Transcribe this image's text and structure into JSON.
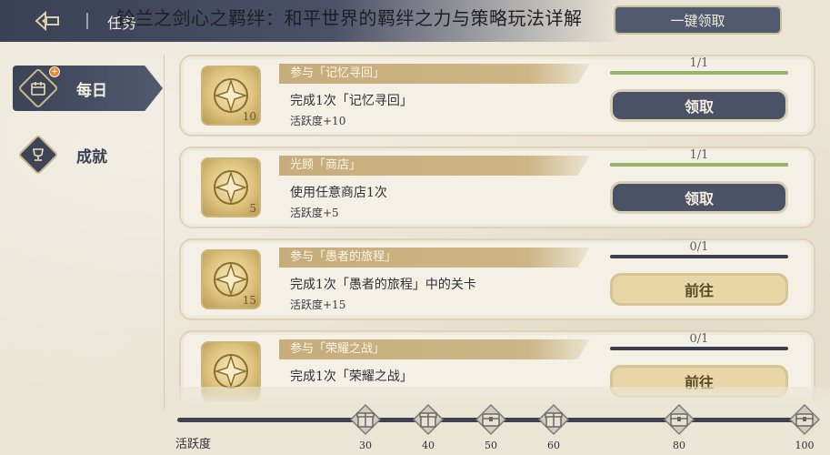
{
  "overlay_title": "铃兰之剑心之羁绊：和平世界的羁绊之力与策略玩法详解",
  "topbar": {
    "title": "任务",
    "top_claim_label": "一键领取"
  },
  "nav": [
    {
      "label": "每日",
      "icon": "calendar-icon",
      "active": true,
      "badge": "+"
    },
    {
      "label": "成就",
      "icon": "trophy-icon",
      "active": false
    }
  ],
  "tasks": [
    {
      "tag": "参与「记忆寻回」",
      "desc": "完成1次「记忆寻回」",
      "reward": "活跃度+10",
      "points": "10",
      "progress_text": "1/1",
      "progress": 1.0,
      "button": "领取",
      "button_type": "claim"
    },
    {
      "tag": "光顾「商店」",
      "desc": "使用任意商店1次",
      "reward": "活跃度+5",
      "points": "5",
      "progress_text": "1/1",
      "progress": 1.0,
      "button": "领取",
      "button_type": "claim"
    },
    {
      "tag": "参与「愚者的旅程」",
      "desc": "完成1次「愚者的旅程」中的关卡",
      "reward": "活跃度+15",
      "points": "15",
      "progress_text": "0/1",
      "progress": 0.0,
      "button": "前往",
      "button_type": "go"
    },
    {
      "tag": "参与「荣耀之战」",
      "desc": "完成1次「荣耀之战」",
      "reward": "",
      "points": "",
      "progress_text": "0/1",
      "progress": 0.0,
      "button": "前往",
      "button_type": "go"
    }
  ],
  "activity": {
    "label": "活跃度",
    "max": 100,
    "milestones": [
      {
        "value": 30,
        "label": "30",
        "icon": "gift-box-icon"
      },
      {
        "value": 40,
        "label": "40",
        "icon": "gift-box-icon"
      },
      {
        "value": 50,
        "label": "50",
        "icon": "treasure-chest-icon"
      },
      {
        "value": 60,
        "label": "60",
        "icon": "gift-box-icon"
      },
      {
        "value": 80,
        "label": "80",
        "icon": "treasure-chest-icon"
      },
      {
        "value": 100,
        "label": "100",
        "icon": "treasure-chest-icon"
      }
    ]
  },
  "colors": {
    "accent_dark": "#4b5266",
    "gold": "#c7ad7b",
    "progress_fill": "#9ab36a",
    "bg": "#ebe5d5"
  }
}
